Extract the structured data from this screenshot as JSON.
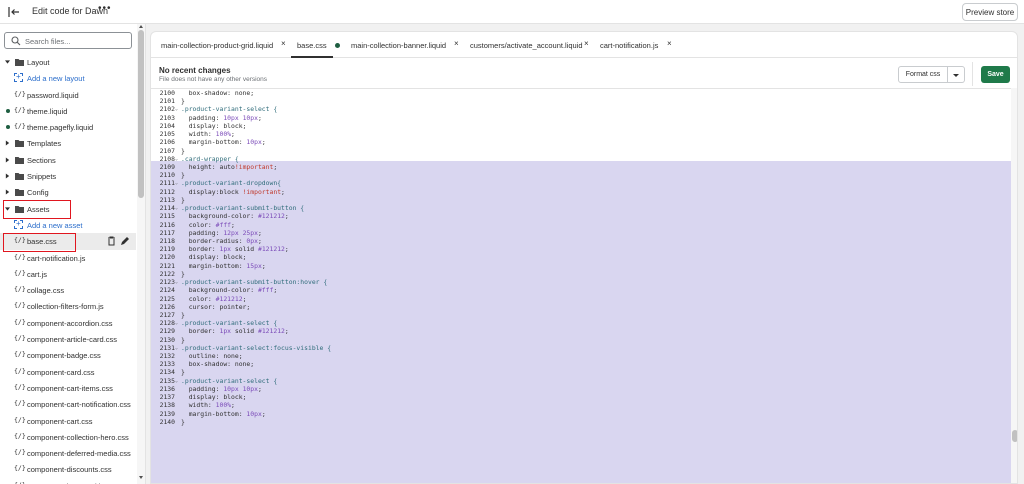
{
  "topbar": {
    "title": "Edit code for Dawn",
    "more": "•••",
    "preview_label": "Preview store"
  },
  "sidebar": {
    "search_placeholder": "Search files...",
    "items": [
      {
        "type": "folder",
        "label": "Layout",
        "open": true
      },
      {
        "type": "add",
        "label": "Add a new layout"
      },
      {
        "type": "file",
        "label": "password.liquid",
        "dot": false
      },
      {
        "type": "file",
        "label": "theme.liquid",
        "dot": true
      },
      {
        "type": "file",
        "label": "theme.pagefly.liquid",
        "dot": true
      },
      {
        "type": "folder",
        "label": "Templates",
        "open": false
      },
      {
        "type": "folder",
        "label": "Sections",
        "open": false
      },
      {
        "type": "folder",
        "label": "Snippets",
        "open": false
      },
      {
        "type": "folder",
        "label": "Config",
        "open": false
      },
      {
        "type": "folder",
        "label": "Assets",
        "open": true
      },
      {
        "type": "add",
        "label": "Add a new asset"
      },
      {
        "type": "file",
        "label": "base.css",
        "selected": true
      },
      {
        "type": "file",
        "label": "cart-notification.js"
      },
      {
        "type": "file",
        "label": "cart.js"
      },
      {
        "type": "file",
        "label": "collage.css"
      },
      {
        "type": "file",
        "label": "collection-filters-form.js"
      },
      {
        "type": "file",
        "label": "component-accordion.css"
      },
      {
        "type": "file",
        "label": "component-article-card.css"
      },
      {
        "type": "file",
        "label": "component-badge.css"
      },
      {
        "type": "file",
        "label": "component-card.css"
      },
      {
        "type": "file",
        "label": "component-cart-items.css"
      },
      {
        "type": "file",
        "label": "component-cart-notification.css"
      },
      {
        "type": "file",
        "label": "component-cart.css"
      },
      {
        "type": "file",
        "label": "component-collection-hero.css"
      },
      {
        "type": "file",
        "label": "component-deferred-media.css"
      },
      {
        "type": "file",
        "label": "component-discounts.css"
      },
      {
        "type": "file",
        "label": "component-image-with-text.css"
      }
    ]
  },
  "tabs": [
    {
      "label": "main-collection-product-grid.liquid",
      "close": "×"
    },
    {
      "label": "base.css",
      "dot": true,
      "active": true
    },
    {
      "label": "main-collection-banner.liquid",
      "close": "×"
    },
    {
      "label": "customers/activate_account.liquid",
      "close": "×"
    },
    {
      "label": "cart-notification.js",
      "close": "×"
    }
  ],
  "toolbar": {
    "title": "No recent changes",
    "subtitle": "File does not have any other versions",
    "format_label": "Format css",
    "save_label": "Save"
  },
  "code": {
    "lines": [
      {
        "n": "2100",
        "t": "  box-shadow: none;"
      },
      {
        "n": "2101",
        "t": "}"
      },
      {
        "n": "2102",
        "t": ".product-variant-select {",
        "fold": true
      },
      {
        "n": "2103",
        "t": "  padding: 10px 10px;"
      },
      {
        "n": "2104",
        "t": "  display: block;"
      },
      {
        "n": "2105",
        "t": "  width: 100%;"
      },
      {
        "n": "2106",
        "t": "  margin-bottom: 10px;"
      },
      {
        "n": "2107",
        "t": "}"
      },
      {
        "n": "2108",
        "t": ".card-wrapper {",
        "fold": true,
        "sel": true
      },
      {
        "n": "2109",
        "t": "  height: auto!important;",
        "sel": true
      },
      {
        "n": "2110",
        "t": "}",
        "sel": true
      },
      {
        "n": "2111",
        "t": ".product-variant-dropdown{",
        "fold": true,
        "sel": true
      },
      {
        "n": "2112",
        "t": "  display:block !important;",
        "sel": true
      },
      {
        "n": "2113",
        "t": "}",
        "sel": true
      },
      {
        "n": "2114",
        "t": ".product-variant-submit-button {",
        "fold": true,
        "sel": true
      },
      {
        "n": "2115",
        "t": "  background-color: #121212;",
        "sel": true
      },
      {
        "n": "2116",
        "t": "  color: #fff;",
        "sel": true
      },
      {
        "n": "2117",
        "t": "  padding: 12px 25px;",
        "sel": true
      },
      {
        "n": "2118",
        "t": "  border-radius: 0px;",
        "sel": true
      },
      {
        "n": "2119",
        "t": "  border: 1px solid #121212;",
        "sel": true
      },
      {
        "n": "2120",
        "t": "  display: block;",
        "sel": true
      },
      {
        "n": "2121",
        "t": "  margin-bottom: 15px;",
        "sel": true
      },
      {
        "n": "2122",
        "t": "}",
        "sel": true
      },
      {
        "n": "2123",
        "t": ".product-variant-submit-button:hover {",
        "fold": true,
        "sel": true
      },
      {
        "n": "2124",
        "t": "  background-color: #fff;",
        "sel": true
      },
      {
        "n": "2125",
        "t": "  color: #121212;",
        "sel": true
      },
      {
        "n": "2126",
        "t": "  cursor: pointer;",
        "sel": true
      },
      {
        "n": "2127",
        "t": "}",
        "sel": true
      },
      {
        "n": "2128",
        "t": ".product-variant-select {",
        "fold": true,
        "sel": true
      },
      {
        "n": "2129",
        "t": "  border: 1px solid #121212;",
        "sel": true
      },
      {
        "n": "2130",
        "t": "}",
        "sel": true
      },
      {
        "n": "2131",
        "t": ".product-variant-select:focus-visible {",
        "fold": true,
        "sel": true
      },
      {
        "n": "2132",
        "t": "  outline: none;",
        "sel": true
      },
      {
        "n": "2133",
        "t": "  box-shadow: none;",
        "sel": true
      },
      {
        "n": "2134",
        "t": "}",
        "sel": true
      },
      {
        "n": "2135",
        "t": ".product-variant-select {",
        "fold": true,
        "sel": true
      },
      {
        "n": "2136",
        "t": "  padding: 10px 10px;",
        "sel": true
      },
      {
        "n": "2137",
        "t": "  display: block;",
        "sel": true
      },
      {
        "n": "2138",
        "t": "  width: 100%;",
        "sel": true
      },
      {
        "n": "2139",
        "t": "  margin-bottom: 10px;",
        "sel": true
      },
      {
        "n": "2140",
        "t": "}",
        "sel": true
      }
    ]
  },
  "colors": {
    "save": "#1f7a4a",
    "selection": "#d9d6f0",
    "highlight_box": "#e0161f",
    "link": "#2c6ecb"
  }
}
